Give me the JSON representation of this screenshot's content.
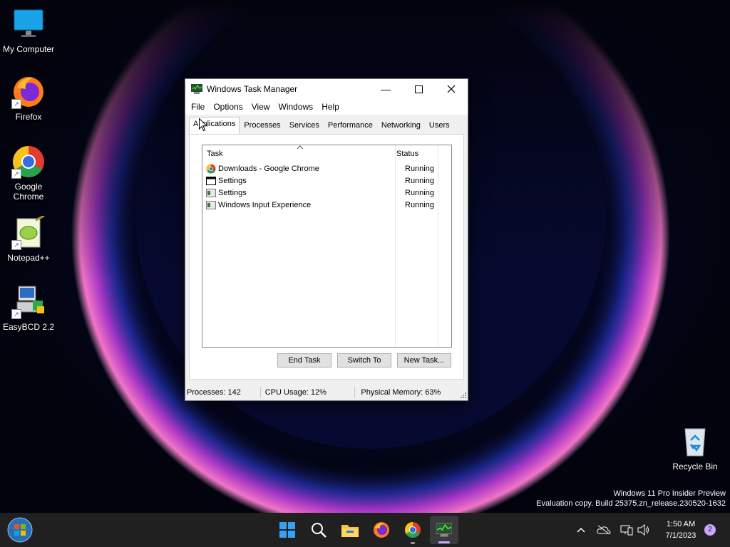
{
  "desktop": {
    "icons": [
      {
        "label": "My Computer"
      },
      {
        "label": "Firefox"
      },
      {
        "label": "Google Chrome"
      },
      {
        "label": "Notepad++"
      },
      {
        "label": "EasyBCD 2.2"
      },
      {
        "label": "Recycle Bin"
      }
    ],
    "watermark": {
      "line1": "Windows 11 Pro Insider Preview",
      "line2": "Evaluation copy. Build 25375.zn_release.230520-1632"
    }
  },
  "window": {
    "title": "Windows Task Manager",
    "menu": [
      "File",
      "Options",
      "View",
      "Windows",
      "Help"
    ],
    "tabs": [
      "Applications",
      "Processes",
      "Services",
      "Performance",
      "Networking",
      "Users"
    ],
    "active_tab": "Applications",
    "columns": {
      "task": "Task",
      "status": "Status"
    },
    "rows": [
      {
        "task": "Downloads - Google Chrome",
        "status": "Running",
        "icon": "chrome-icon"
      },
      {
        "task": "Settings",
        "status": "Running",
        "icon": "window-icon"
      },
      {
        "task": "Settings",
        "status": "Running",
        "icon": "app-icon"
      },
      {
        "task": "Windows Input Experience",
        "status": "Running",
        "icon": "app-icon"
      }
    ],
    "buttons": {
      "end_task": "End Task",
      "switch_to": "Switch To",
      "new_task": "New Task..."
    },
    "statusbar": {
      "processes": "Processes: 142",
      "cpu": "CPU Usage: 12%",
      "memory": "Physical Memory: 63%"
    }
  },
  "taskbar": {
    "time": "1:50 AM",
    "date": "7/1/2023",
    "notification_count": "2"
  }
}
